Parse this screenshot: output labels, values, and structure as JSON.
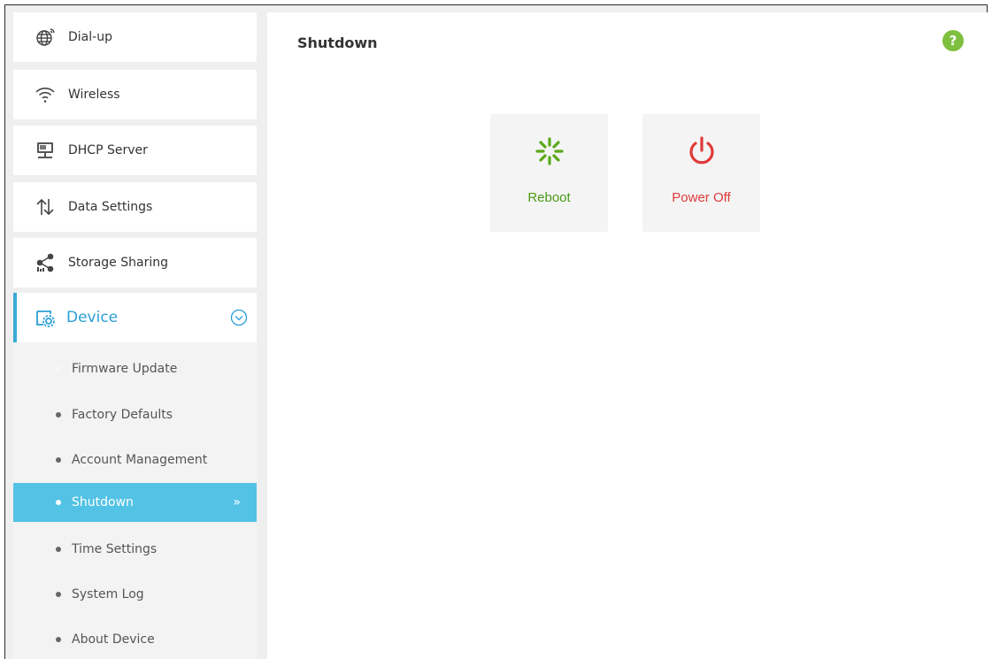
{
  "sidebar": {
    "items": [
      {
        "label": "Dial-up",
        "icon": "globe-icon"
      },
      {
        "label": "Wireless",
        "icon": "wifi-icon"
      },
      {
        "label": "DHCP Server",
        "icon": "dhcp-server-icon"
      },
      {
        "label": "Data Settings",
        "icon": "data-arrows-icon"
      },
      {
        "label": "Storage Sharing",
        "icon": "share-icon"
      }
    ],
    "device": {
      "label": "Device",
      "icon": "device-settings-icon",
      "expanded": true
    },
    "sub_items": [
      {
        "label": "Firmware Update"
      },
      {
        "label": "Factory Defaults"
      },
      {
        "label": "Account Management"
      },
      {
        "label": "Shutdown",
        "active": true
      },
      {
        "label": "Time Settings"
      },
      {
        "label": "System Log"
      },
      {
        "label": "About Device"
      }
    ],
    "active_arrow": "»"
  },
  "main": {
    "title": "Shutdown",
    "help": "?",
    "tiles": [
      {
        "label": "Reboot",
        "icon": "reboot-spinner-icon",
        "color": "#4a9a1a"
      },
      {
        "label": "Power Off",
        "icon": "power-icon",
        "color": "#e03a3a"
      }
    ]
  },
  "colors": {
    "accent": "#3aa9d8",
    "active_bg": "#52c2e5",
    "help_green": "#7fbf3f"
  }
}
